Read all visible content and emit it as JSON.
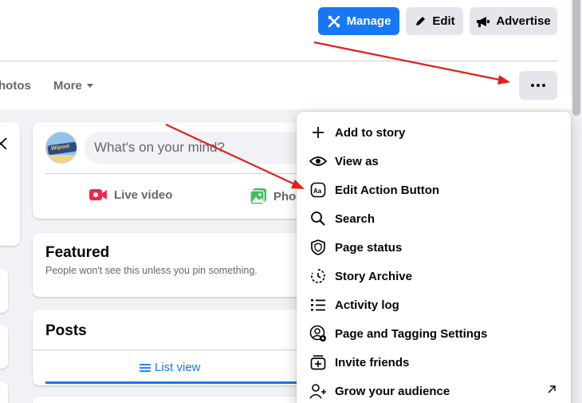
{
  "header": {
    "manage_label": "Manage",
    "edit_label": "Edit",
    "advertise_label": "Advertise"
  },
  "tabs": {
    "photos_label": "hotos",
    "more_label": "More"
  },
  "composer": {
    "placeholder": "What's on your mind?",
    "avatar_text": "Wipool",
    "live_video_label": "Live video",
    "photo_label": "Photo"
  },
  "featured": {
    "title": "Featured",
    "subtitle": "People won't see this unless you pin something."
  },
  "posts": {
    "title": "Posts",
    "list_view_label": "List view"
  },
  "menu": {
    "items": [
      {
        "label": "Add to story",
        "icon": "plus-icon"
      },
      {
        "label": "View as",
        "icon": "eye-icon"
      },
      {
        "label": "Edit Action Button",
        "icon": "action-button-icon"
      },
      {
        "label": "Search",
        "icon": "search-icon"
      },
      {
        "label": "Page status",
        "icon": "shield-icon"
      },
      {
        "label": "Story Archive",
        "icon": "story-archive-icon"
      },
      {
        "label": "Activity log",
        "icon": "list-icon"
      },
      {
        "label": "Page and Tagging Settings",
        "icon": "settings-user-icon"
      },
      {
        "label": "Invite friends",
        "icon": "invite-icon"
      },
      {
        "label": "Grow your audience",
        "icon": "add-person-icon"
      }
    ]
  },
  "colors": {
    "accent": "#1877f2",
    "button_gray": "#e4e6eb",
    "background": "#f0f2f5",
    "annotation_arrow": "#e0201a",
    "live_red": "#f02849",
    "photo_green": "#45bd62"
  }
}
